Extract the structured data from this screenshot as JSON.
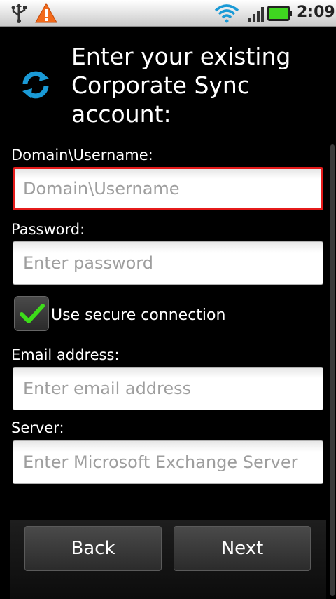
{
  "status_bar": {
    "time": "2:09",
    "icons": [
      "usb-icon",
      "warning-icon",
      "wifi-icon",
      "signal-icon",
      "battery-icon"
    ]
  },
  "header": {
    "icon": "sync-icon",
    "title": "Enter your existing Corporate Sync account:"
  },
  "form": {
    "username": {
      "label": "Domain\\Username:",
      "placeholder": "Domain\\Username",
      "value": "",
      "focused": true
    },
    "password": {
      "label": "Password:",
      "placeholder": "Enter password",
      "value": ""
    },
    "secure": {
      "label": "Use secure connection",
      "checked": true
    },
    "email": {
      "label": "Email address:",
      "placeholder": "Enter email address",
      "value": ""
    },
    "server": {
      "label": "Server:",
      "placeholder": "Enter Microsoft Exchange Server",
      "value": ""
    }
  },
  "footer": {
    "back_label": "Back",
    "next_label": "Next"
  },
  "colors": {
    "focus_border": "#e51b1b",
    "check_green": "#3ddc1a",
    "sync_blue": "#1a9ad6"
  }
}
